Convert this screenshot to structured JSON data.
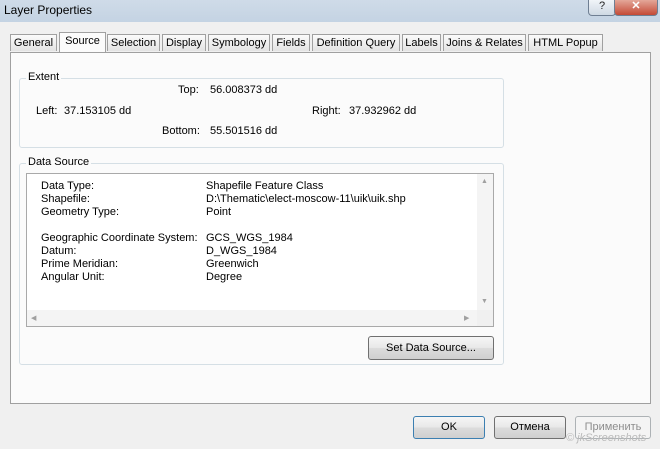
{
  "window": {
    "title": "Layer Properties",
    "help_glyph": "?",
    "close_glyph": "✕"
  },
  "tabs": [
    {
      "label": "General"
    },
    {
      "label": "Source"
    },
    {
      "label": "Selection"
    },
    {
      "label": "Display"
    },
    {
      "label": "Symbology"
    },
    {
      "label": "Fields"
    },
    {
      "label": "Definition Query"
    },
    {
      "label": "Labels"
    },
    {
      "label": "Joins & Relates"
    },
    {
      "label": "HTML Popup"
    }
  ],
  "extent": {
    "group_label": "Extent",
    "top_label": "Top:",
    "top_value": "56.008373 dd",
    "left_label": "Left:",
    "left_value": "37.153105 dd",
    "right_label": "Right:",
    "right_value": "37.932962 dd",
    "bottom_label": "Bottom:",
    "bottom_value": "55.501516 dd"
  },
  "data_source": {
    "group_label": "Data Source",
    "rows": [
      {
        "key": "Data Type:",
        "value": "Shapefile Feature Class"
      },
      {
        "key": "Shapefile:",
        "value": "D:\\Thematic\\elect-moscow-11\\uik\\uik.shp"
      },
      {
        "key": "Geometry Type:",
        "value": "Point"
      },
      {
        "key": "Geographic Coordinate System:",
        "value": "GCS_WGS_1984"
      },
      {
        "key": "Datum:",
        "value": "D_WGS_1984"
      },
      {
        "key": "Prime Meridian:",
        "value": "Greenwich"
      },
      {
        "key": "Angular Unit:",
        "value": "Degree"
      }
    ],
    "set_button": "Set Data Source..."
  },
  "footer": {
    "ok": "OK",
    "cancel": "Отмена",
    "apply": "Применить"
  },
  "watermark": "© jkScreenshots"
}
